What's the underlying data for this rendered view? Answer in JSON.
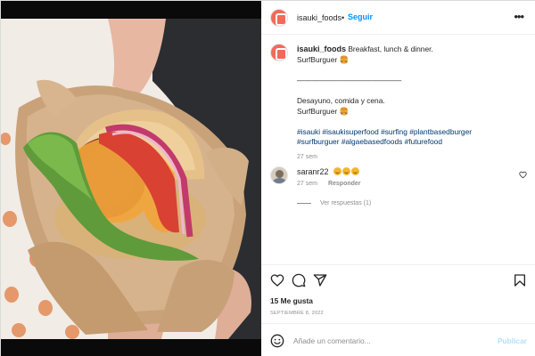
{
  "post": {
    "username": "isauki_foods",
    "separator": "•",
    "follow_label": "Seguir",
    "more_label": "•••",
    "caption": {
      "author": "isauki_foods",
      "line1_text": "Breakfast, lunch & dinner.",
      "line2": "SurfBurguer 🍔",
      "divider": "——————————————",
      "line4": "Desayuno, comida y cena.",
      "line5": "SurfBurguer 🍔",
      "hashtags_line1": [
        "#isauki",
        "#isaukisuperfood",
        "#surfing",
        "#plantbasedburger"
      ],
      "hashtags_line2": [
        "#surfburguer",
        "#algaebasedfoods",
        "#futurefood"
      ],
      "time": "27 sem"
    },
    "comments": [
      {
        "username": "saranr22",
        "emoji": "😊😊😊",
        "time": "27 sem",
        "reply_label": "Responder",
        "view_replies_label": "Ver respuestas (1)"
      }
    ],
    "likes_label": "15 Me gusta",
    "date_label": "SEPTIEMBRE 8, 2022",
    "add_comment_placeholder": "Añade un comentario...",
    "publish_label": "Publicar"
  },
  "icons": {
    "avatar": "isauki-logo-icon",
    "heart": "heart-icon",
    "comment": "comment-icon",
    "share": "paper-plane-icon",
    "save": "bookmark-icon",
    "emoji": "smiley-face-icon"
  },
  "colors": {
    "link": "#00376b",
    "follow": "#0095f6",
    "publish_disabled": "#b2dffc",
    "brand_avatar": "#f26a5a"
  }
}
